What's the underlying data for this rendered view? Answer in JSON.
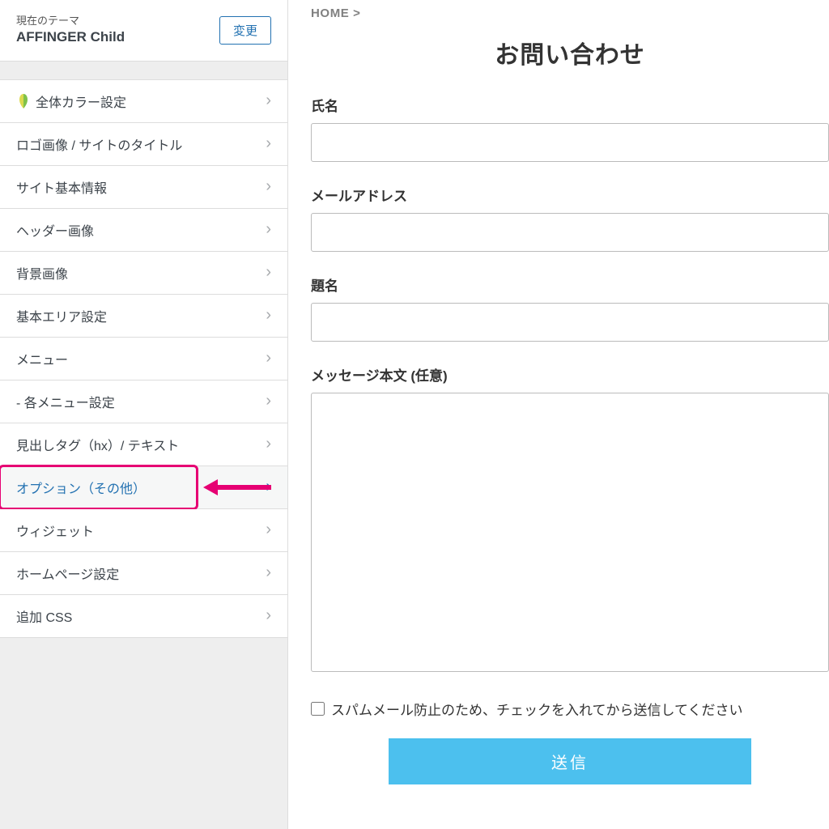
{
  "sidebar": {
    "current_theme_label": "現在のテーマ",
    "theme_name": "AFFINGER Child",
    "change_button": "変更",
    "items": [
      {
        "label": "全体カラー設定",
        "icon": "leaf"
      },
      {
        "label": "ロゴ画像 / サイトのタイトル"
      },
      {
        "label": "サイト基本情報"
      },
      {
        "label": "ヘッダー画像"
      },
      {
        "label": "背景画像"
      },
      {
        "label": "基本エリア設定"
      },
      {
        "label": "メニュー"
      },
      {
        "label": "- 各メニュー設定"
      },
      {
        "label": "見出しタグ（hx）/ テキスト"
      },
      {
        "label": "オプション（その他）",
        "active": true
      },
      {
        "label": "ウィジェット"
      },
      {
        "label": "ホームページ設定"
      },
      {
        "label": "追加 CSS"
      }
    ]
  },
  "preview": {
    "breadcrumb": "HOME >",
    "title": "お問い合わせ",
    "fields": {
      "name_label": "氏名",
      "email_label": "メールアドレス",
      "subject_label": "題名",
      "message_label": "メッセージ本文 (任意)"
    },
    "spam_check_label": "スパムメール防止のため、チェックを入れてから送信してください",
    "submit_label": "送信"
  },
  "annotation": {
    "color": "#e60073"
  }
}
